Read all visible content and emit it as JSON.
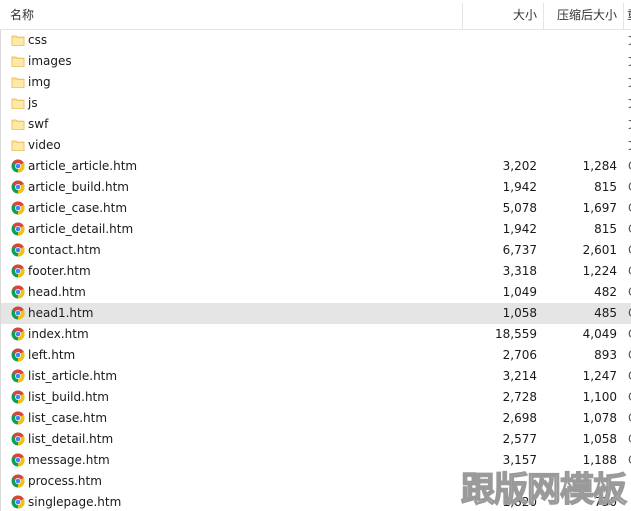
{
  "columns": {
    "name": "名称",
    "size": "大小",
    "compressed": "压缩后大小",
    "clipped": "重"
  },
  "files": [
    {
      "name": "css",
      "type": "folder",
      "size": "",
      "compressed": "",
      "clipped": "文"
    },
    {
      "name": "images",
      "type": "folder",
      "size": "",
      "compressed": "",
      "clipped": "文"
    },
    {
      "name": "img",
      "type": "folder",
      "size": "",
      "compressed": "",
      "clipped": "文"
    },
    {
      "name": "js",
      "type": "folder",
      "size": "",
      "compressed": "",
      "clipped": "文"
    },
    {
      "name": "swf",
      "type": "folder",
      "size": "",
      "compressed": "",
      "clipped": "文"
    },
    {
      "name": "video",
      "type": "folder",
      "size": "",
      "compressed": "",
      "clipped": "文"
    },
    {
      "name": "article_article.htm",
      "type": "htm",
      "size": "3,202",
      "compressed": "1,284",
      "clipped": "C"
    },
    {
      "name": "article_build.htm",
      "type": "htm",
      "size": "1,942",
      "compressed": "815",
      "clipped": "C"
    },
    {
      "name": "article_case.htm",
      "type": "htm",
      "size": "5,078",
      "compressed": "1,697",
      "clipped": "C"
    },
    {
      "name": "article_detail.htm",
      "type": "htm",
      "size": "1,942",
      "compressed": "815",
      "clipped": "C"
    },
    {
      "name": "contact.htm",
      "type": "htm",
      "size": "6,737",
      "compressed": "2,601",
      "clipped": "C"
    },
    {
      "name": "footer.htm",
      "type": "htm",
      "size": "3,318",
      "compressed": "1,224",
      "clipped": "C"
    },
    {
      "name": "head.htm",
      "type": "htm",
      "size": "1,049",
      "compressed": "482",
      "clipped": "C"
    },
    {
      "name": "head1.htm",
      "type": "htm",
      "size": "1,058",
      "compressed": "485",
      "clipped": "C"
    },
    {
      "name": "index.htm",
      "type": "htm",
      "size": "18,559",
      "compressed": "4,049",
      "clipped": "C"
    },
    {
      "name": "left.htm",
      "type": "htm",
      "size": "2,706",
      "compressed": "893",
      "clipped": "C"
    },
    {
      "name": "list_article.htm",
      "type": "htm",
      "size": "3,214",
      "compressed": "1,247",
      "clipped": "C"
    },
    {
      "name": "list_build.htm",
      "type": "htm",
      "size": "2,728",
      "compressed": "1,100",
      "clipped": "C"
    },
    {
      "name": "list_case.htm",
      "type": "htm",
      "size": "2,698",
      "compressed": "1,078",
      "clipped": "C"
    },
    {
      "name": "list_detail.htm",
      "type": "htm",
      "size": "2,577",
      "compressed": "1,058",
      "clipped": "C"
    },
    {
      "name": "message.htm",
      "type": "htm",
      "size": "3,157",
      "compressed": "1,188",
      "clipped": "C"
    },
    {
      "name": "process.htm",
      "type": "htm",
      "size": "",
      "compressed": "",
      "clipped": ""
    },
    {
      "name": "singlepage.htm",
      "type": "htm",
      "size": "1,820",
      "compressed": "730",
      "clipped": ""
    }
  ],
  "hovered_row": 13,
  "icons": {
    "folder": "folder-icon",
    "htm": "chrome-document-icon"
  },
  "colors": {
    "folder_fill": "#ffe08a",
    "folder_edge": "#e4b84a",
    "hover_bg": "#e5e5e5",
    "chrome_red": "#db4437",
    "chrome_yellow": "#f4c20d",
    "chrome_green": "#0f9d58",
    "chrome_blue": "#4285f4"
  },
  "watermark": {
    "text": "跟版网模板"
  }
}
